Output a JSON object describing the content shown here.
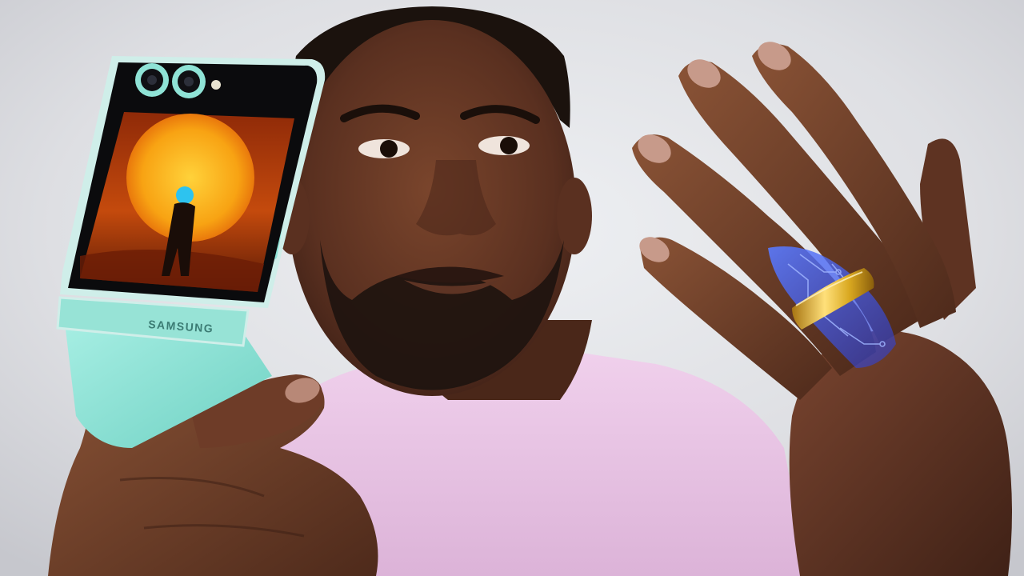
{
  "image": {
    "kind": "photo",
    "description_free": true
  },
  "phone": {
    "brand_text": "SAMSUNG",
    "body_color": "#8fe3d6",
    "frame_color": "#cfeee9"
  },
  "ring": {
    "color": "#d9a820"
  },
  "colors": {
    "background": "#dfe0e4",
    "shirt": "#e9c6e6",
    "skin": "#5a3222",
    "sun": "#f7a514",
    "screen_sky": "#c2410c",
    "circuit_glow": "#3d5cff"
  }
}
